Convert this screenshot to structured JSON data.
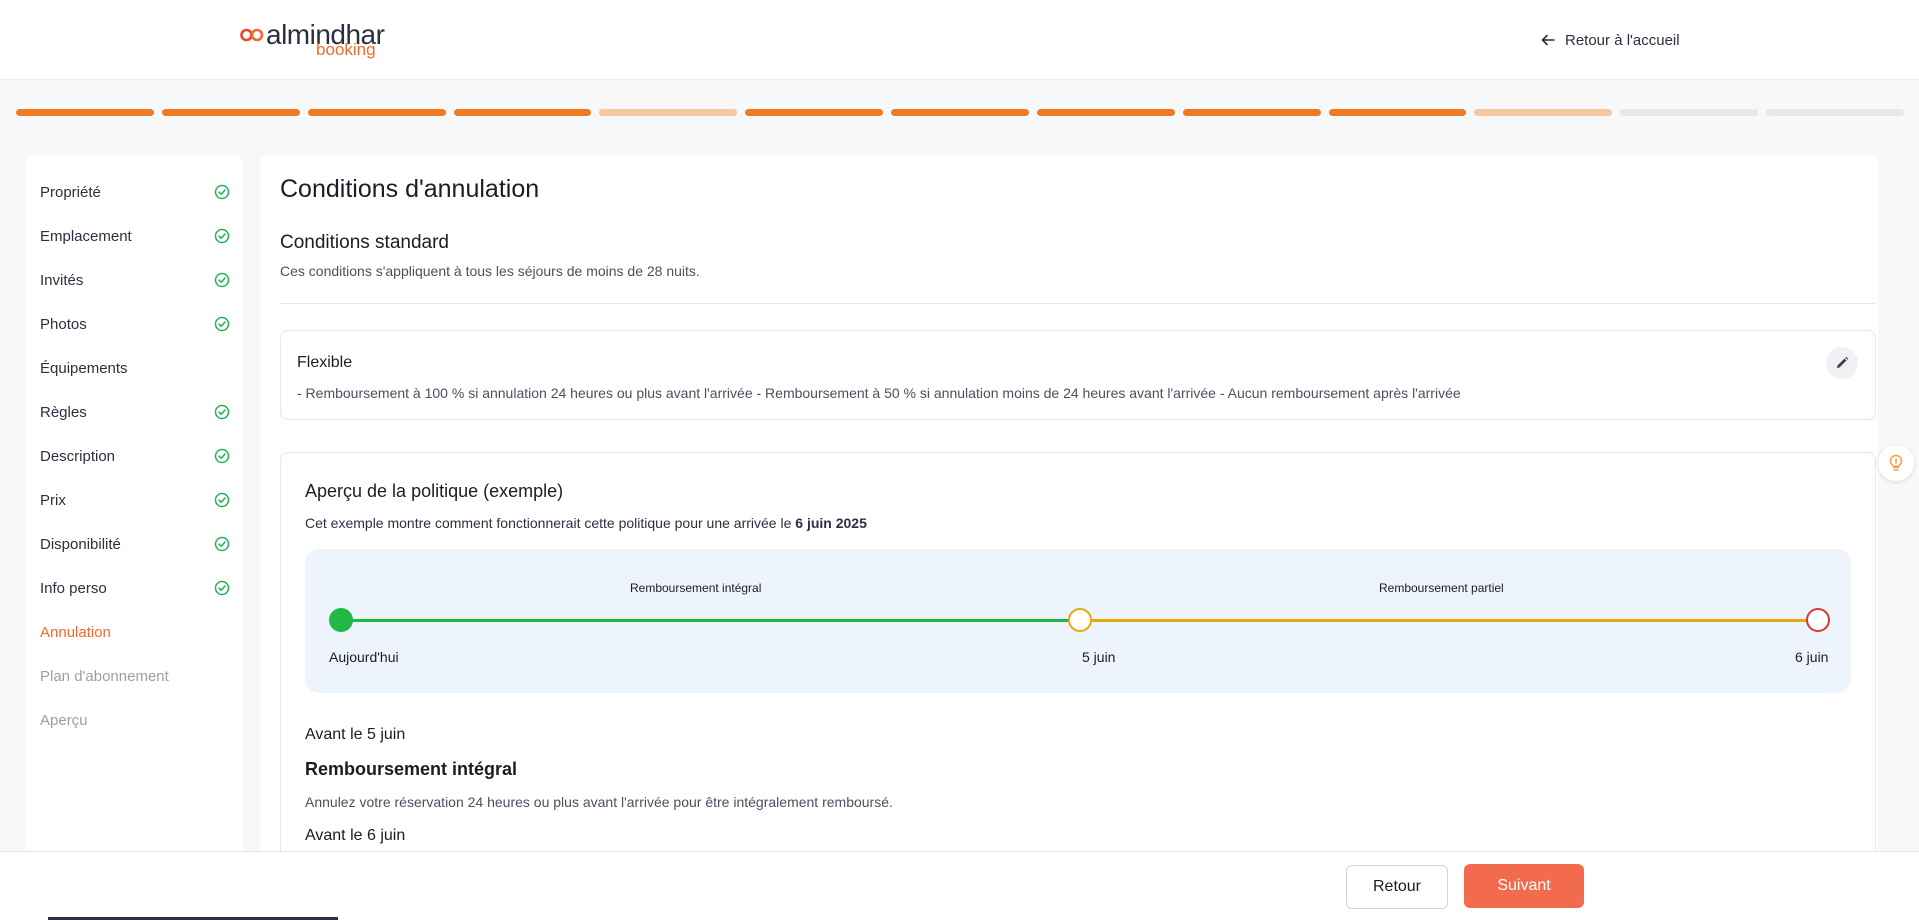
{
  "header": {
    "logo_brand": "almindhar",
    "logo_sub": "booking",
    "back_home": "Retour à l'accueil"
  },
  "progress": {
    "total_steps": 13,
    "segments": [
      "done",
      "done",
      "done",
      "done",
      "partial",
      "done",
      "done",
      "done",
      "done",
      "done",
      "partial",
      "todo",
      "todo"
    ]
  },
  "colors": {
    "accent": "#f26a2c",
    "done": "#f07a22",
    "partial": "#f7c7a0",
    "todo": "#e6e7ea",
    "check": "#22b35a",
    "full_refund": "#22b845",
    "partial_refund": "#e8a80a",
    "no_refund": "#d93636",
    "next_button": "#f36b4e"
  },
  "sidebar": {
    "items": [
      {
        "label": "Propriété",
        "state": "done"
      },
      {
        "label": "Emplacement",
        "state": "done"
      },
      {
        "label": "Invités",
        "state": "done"
      },
      {
        "label": "Photos",
        "state": "done"
      },
      {
        "label": "Équipements",
        "state": "pending"
      },
      {
        "label": "Règles",
        "state": "done"
      },
      {
        "label": "Description",
        "state": "done"
      },
      {
        "label": "Prix",
        "state": "done"
      },
      {
        "label": "Disponibilité",
        "state": "done"
      },
      {
        "label": "Info perso",
        "state": "done"
      },
      {
        "label": "Annulation",
        "state": "active"
      },
      {
        "label": "Plan d'abonnement",
        "state": "disabled"
      },
      {
        "label": "Aperçu",
        "state": "disabled"
      }
    ]
  },
  "main": {
    "title": "Conditions d'annulation",
    "section_title": "Conditions standard",
    "section_desc": "Ces conditions s'appliquent à tous les séjours de moins de 28 nuits.",
    "policy": {
      "name": "Flexible",
      "text": "- Remboursement à 100 % si annulation 24 heures ou plus avant l'arrivée - Remboursement à 50 % si annulation moins de 24 heures avant l'arrivée - Aucun remboursement après l'arrivée"
    },
    "preview": {
      "title": "Aperçu de la politique (exemple)",
      "desc_prefix": "Cet exemple montre comment fonctionnerait cette politique pour une arrivée le ",
      "desc_date": "6 juin 2025",
      "timeline": {
        "label_full": "Remboursement intégral",
        "label_partial": "Remboursement partiel",
        "start": "Aujourd'hui",
        "middle": "5 juin",
        "end": "6 juin"
      },
      "rules": [
        {
          "when": "Avant le 5 juin",
          "title": "Remboursement intégral",
          "desc": "Annulez votre réservation 24 heures ou plus avant l'arrivée pour être intégralement remboursé."
        },
        {
          "when": "Avant le 6 juin"
        }
      ]
    }
  },
  "footer": {
    "back": "Retour",
    "next": "Suivant"
  }
}
